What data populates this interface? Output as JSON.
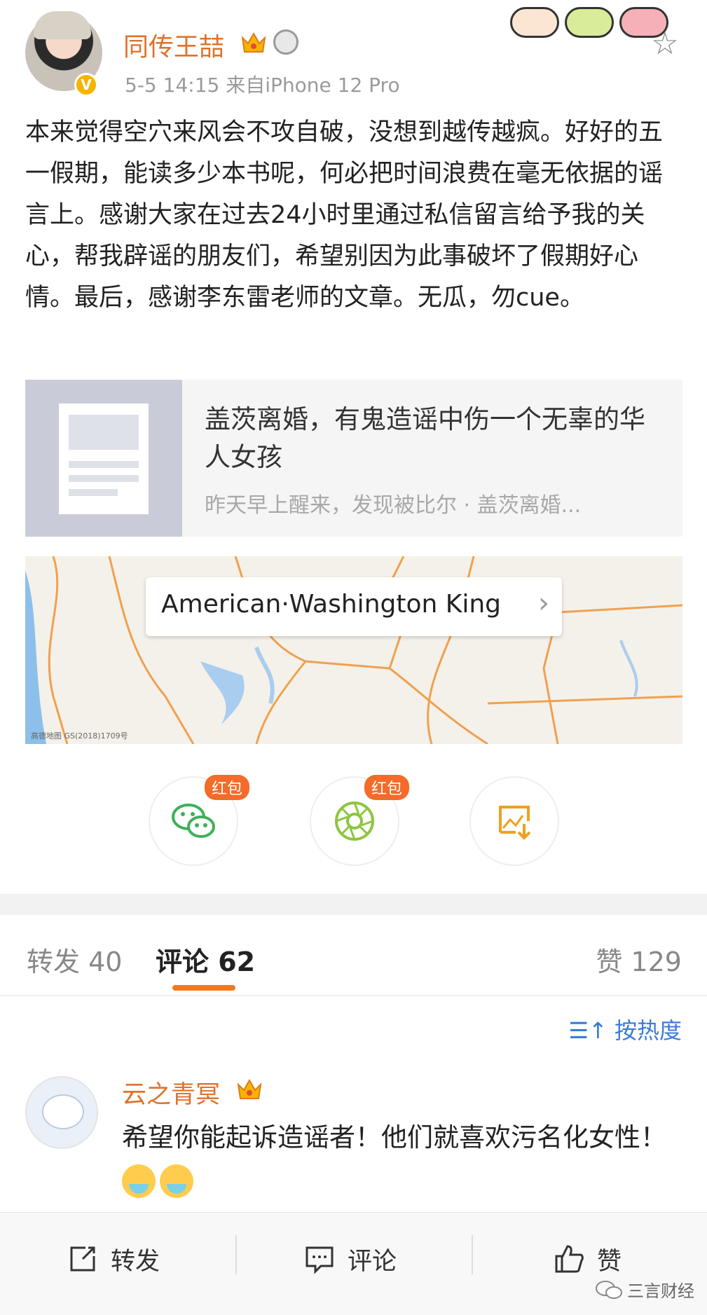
{
  "post": {
    "username": "同传王喆",
    "meta": "5-5 14:15  来自iPhone 12 Pro",
    "body": "本来觉得空穴来风会不攻自破，没想到越传越疯。好好的五一假期，能读多少本书呢，何必把时间浪费在毫无依据的谣言上。感谢大家在过去24小时里通过私信留言给予我的关心，帮我辟谣的朋友们，希望别因为此事破坏了假期好心情。最后，感谢李东雷老师的文章。无瓜，勿cue。"
  },
  "article": {
    "title": "盖茨离婚，有鬼造谣中伤一个无辜的华人女孩",
    "desc": "昨天早上醒来，发现被比尔 · 盖茨离婚..."
  },
  "map": {
    "label": "American·Washington King",
    "credit": "高德地图 GS(2018)1709号"
  },
  "share": {
    "badge": "红包"
  },
  "tabs": {
    "repost": "转发 40",
    "comment": "评论 62",
    "like": "赞 129"
  },
  "sort": {
    "label": "按热度"
  },
  "comment": {
    "name": "云之青冥",
    "text": "希望你能起诉造谣者！他们就喜欢污名化女性！"
  },
  "bottom_bar": {
    "repost": "转发",
    "comment": "评论",
    "like": "赞"
  },
  "watermark": "三言财经",
  "colors": {
    "accent_orange": "#e0712a",
    "tab_underline": "#f07a20",
    "link_blue": "#3b7bd8",
    "badge_red": "#f56b2a"
  }
}
